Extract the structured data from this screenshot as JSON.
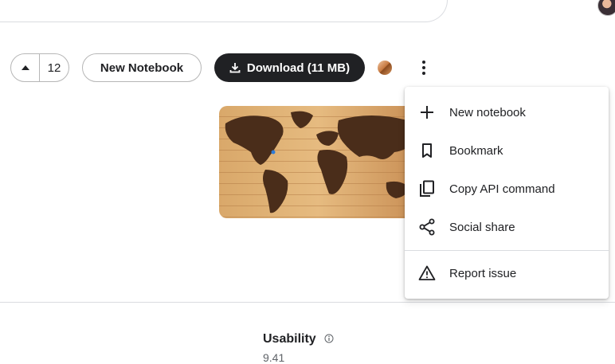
{
  "vote": {
    "count": "12"
  },
  "actions": {
    "new_notebook_label": "New Notebook",
    "download_label": "Download (11 MB)"
  },
  "menu": {
    "items": [
      {
        "label": "New notebook",
        "icon": "plus-icon"
      },
      {
        "label": "Bookmark",
        "icon": "bookmark-icon"
      },
      {
        "label": "Copy API command",
        "icon": "copy-icon"
      },
      {
        "label": "Social share",
        "icon": "share-icon"
      },
      {
        "label": "Report issue",
        "icon": "warning-icon"
      }
    ]
  },
  "usability": {
    "label": "Usability",
    "score": "9.41"
  },
  "colors": {
    "primary_dark": "#202124",
    "border": "#b6b6b6",
    "divider": "#dadce0"
  }
}
